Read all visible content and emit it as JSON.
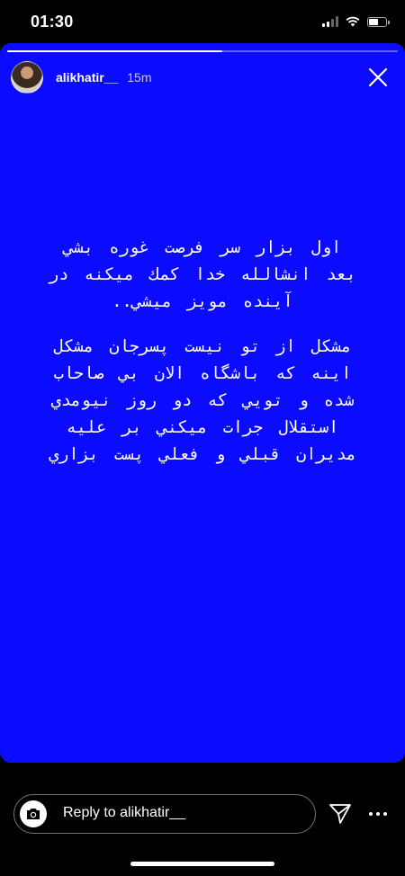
{
  "status_bar": {
    "time": "01:30",
    "battery_level": 0.6
  },
  "story": {
    "background_color": "#0b0bff",
    "progress": 0.55,
    "username": "alikhatir__",
    "time_ago": "15m",
    "paragraph1": [
      "اول بزار سر فرصت غوره بشي",
      "بعد انشالله خدا كمك ميكنه در",
      "آينده مويز ميشي.."
    ],
    "paragraph2": [
      "مشكل از تو نيست پسرجان مشكل",
      "اينه كه باشگاه الان بي صاحاب",
      "شده و تويي كه دو روز نيومدي",
      "استقلال جرات ميكني بر عليه",
      "مديران قبلي و فعلي پست بزاري"
    ]
  },
  "reply": {
    "placeholder": "Reply to alikhatir__"
  },
  "icons": {
    "close": "close-icon",
    "camera": "camera-icon",
    "send": "send-icon",
    "more": "more-icon"
  }
}
